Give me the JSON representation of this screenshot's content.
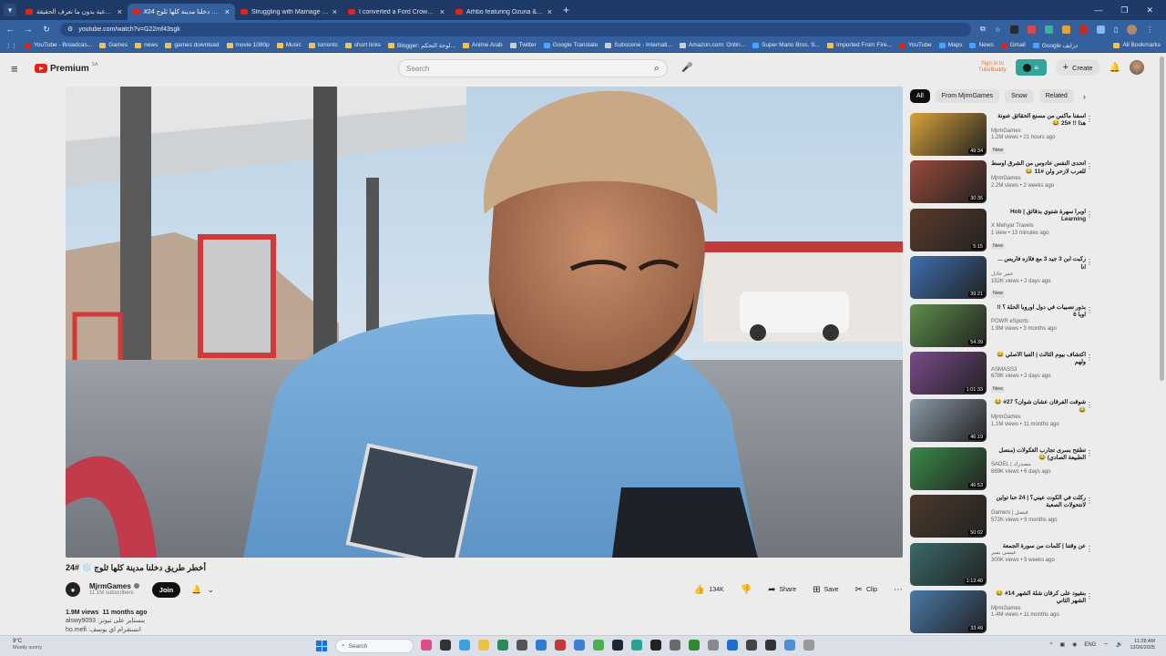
{
  "browser": {
    "tabs": [
      {
        "title": "مفاتيح الرغبة بدون ما تعرف الحقيقة !!",
        "active": false
      },
      {
        "title": "#24 أخطر طريق دخلنا مدينة كلها ثلوج",
        "active": true
      },
      {
        "title": "Struggling with Marriage & Isl",
        "active": false
      },
      {
        "title": "I converted a Ford Crown Victo",
        "active": false
      },
      {
        "title": "Arhbo featuring Ozuna & GIMS",
        "active": false
      }
    ],
    "url": "youtube.com/watch?v=G22mf43sgk",
    "bookmarks": [
      {
        "label": "YouTube - Broadcas...",
        "icon": "red"
      },
      {
        "label": "Games",
        "icon": "folder"
      },
      {
        "label": "news",
        "icon": "folder"
      },
      {
        "label": "games download",
        "icon": "folder"
      },
      {
        "label": "movie 1080p",
        "icon": "folder"
      },
      {
        "label": "Music",
        "icon": "folder"
      },
      {
        "label": "torrents",
        "icon": "folder"
      },
      {
        "label": "short links",
        "icon": "folder"
      },
      {
        "label": "Blogger: لوحة التحكم...",
        "icon": "folder"
      },
      {
        "label": "Anime Arab",
        "icon": "folder"
      },
      {
        "label": "Twitter",
        "icon": "grey"
      },
      {
        "label": "Google Translate",
        "icon": "blue"
      },
      {
        "label": "Subscene - Internati...",
        "icon": "grey"
      },
      {
        "label": "Amazon.com: Onlin...",
        "icon": "grey"
      },
      {
        "label": "Super Mario Bros. S...",
        "icon": "blue"
      },
      {
        "label": "Imported From Fire...",
        "icon": "folder"
      },
      {
        "label": "YouTube",
        "icon": "red"
      },
      {
        "label": "Maps",
        "icon": "blue"
      },
      {
        "label": "News",
        "icon": "blue"
      },
      {
        "label": "Gmail",
        "icon": "red"
      },
      {
        "label": "Google درايف",
        "icon": "blue"
      }
    ],
    "all_bookmarks": "All Bookmarks"
  },
  "yt": {
    "logo": "Premium",
    "logo_sup": "SA",
    "search_placeholder": "Search",
    "signin_line1": "Sign in to",
    "signin_line2": "TubeBuddy",
    "create": "Create"
  },
  "video": {
    "title": "أخطر طريق دخلنا مدينة كلها ثلوج ❄️ #24",
    "channel": "MjrmGames",
    "subscribers": "11.1M subscribers",
    "join": "Join",
    "likes": "134K",
    "share": "Share",
    "save": "Save",
    "clip": "Clip",
    "views": "1.9M views",
    "age": "11 months ago",
    "desc_line1": "alswy9093 :بنستاير على تيوتر",
    "desc_line2": "ho.mefi :انستقرام اي يوسف"
  },
  "chips": [
    "All",
    "From MjrmGames",
    "Snow",
    "Related"
  ],
  "recommendations": [
    {
      "title": "اسفنا ماكس من مسنع الحقائق عنونة هذا !! #25 😂",
      "channel": "MjrmGames",
      "views": "1.2M views",
      "age": "21 hours ago",
      "duration": "49:34",
      "new": true,
      "thumb": "#d8a23a"
    },
    {
      "title": "أتحدى النفس عادوس من الشرق أوسط للعرب لازحر ولن #11 😂",
      "channel": "MjrmGames",
      "views": "2.2M views",
      "age": "2 weeks ago",
      "duration": "30:35",
      "new": false,
      "thumb": "#9a4a3a"
    },
    {
      "title": "اوبرا سهرة شتوي بدقائق | Hob Learning",
      "channel": "X Mehyar Travels",
      "views": "1 view",
      "age": "13 minutes ago",
      "duration": "5:15",
      "new": true,
      "thumb": "#5b3a2a"
    },
    {
      "title": "ركبت ابن 3 جيد 3 مع فلازه فاريس ... انا",
      "channel": "عمر عادل",
      "views": "152K views",
      "age": "2 days ago",
      "duration": "39:21",
      "new": true,
      "thumb": "#3e6fb0"
    },
    {
      "title": "بذور تصبيات في دول أوروبا الحلة ؟ !! اوبا 6",
      "channel": "POWR eSports",
      "views": "1.9M views",
      "age": "3 months ago",
      "duration": "54:39",
      "new": false,
      "thumb": "#5d8f4a"
    },
    {
      "title": "اكتشاف بيوم الثالث | التنبأ الأصلي 😂 ولهم",
      "channel": "ASMASS3",
      "views": "678K views",
      "age": "2 days ago",
      "duration": "1:01:33",
      "new": true,
      "thumb": "#7a4a8a"
    },
    {
      "title": "شوقت الفرقان عشان شوان؟ 27# 😂 😂",
      "channel": "MjrmGames",
      "views": "1.1M views",
      "age": "11 months ago",
      "duration": "46:19",
      "new": false,
      "thumb": "#8a9aa8"
    },
    {
      "title": "تطفح بسرى تجارب الغكولات (منصل الطبيعة الصادي) 😂",
      "channel": "SADEL | مصدرك",
      "views": "669K views",
      "age": "6 days ago",
      "duration": "46:53",
      "new": false,
      "thumb": "#3a8a4a"
    },
    {
      "title": "ركلت في الكوت عيني؟ | 24 حنا تواين لانتحولات الصعبة",
      "channel": "Gamers | فيصل",
      "views": "572K views",
      "age": "9 months ago",
      "duration": "50:02",
      "new": false,
      "thumb": "#4a3a2a"
    },
    {
      "title": "عن وقتنا | كلمات من سورة الجمعة",
      "channel": "عيسى بسر",
      "views": "300K views",
      "age": "5 weeks ago",
      "duration": "1:13:40",
      "new": false,
      "thumb": "#3a6a6a"
    },
    {
      "title": "بنقيود على كرقان شلة الشهر 14# 😂 الشهر الثاني",
      "channel": "MjrmGames",
      "views": "1.4M views",
      "age": "11 months ago",
      "duration": "33:49",
      "new": false,
      "thumb": "#4a7aa8"
    }
  ],
  "taskbar": {
    "temp": "9°C",
    "condition": "Mostly sunny",
    "search": "Search",
    "lang": "ENG",
    "time": "11:28 AM",
    "date": "12/26/2025"
  }
}
